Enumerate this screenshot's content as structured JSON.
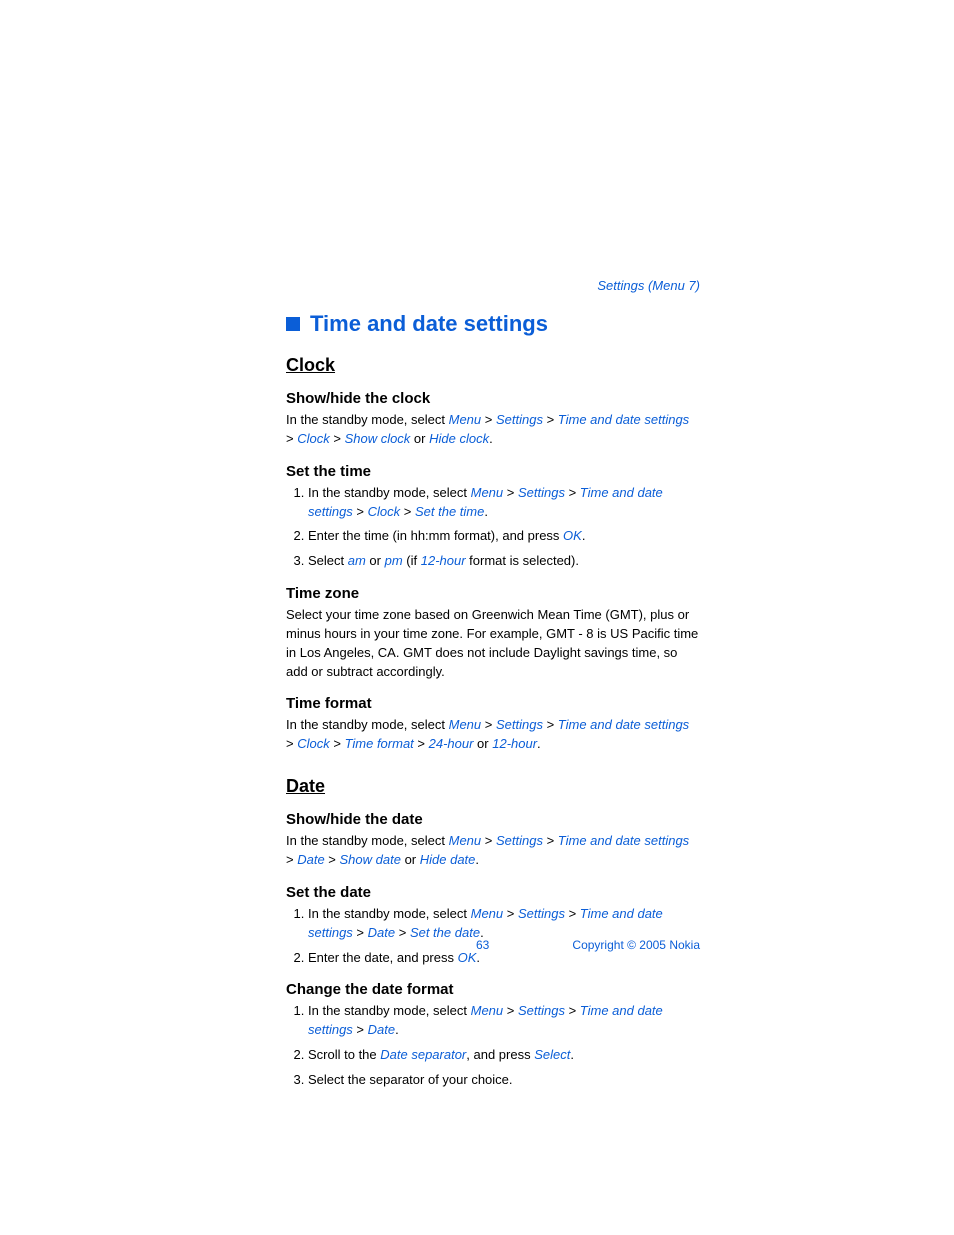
{
  "header": {
    "breadcrumb": "Settings (Menu 7)"
  },
  "title": "Time and date settings",
  "sec_clock": "Clock",
  "clock_showhide": {
    "h": "Show/hide the clock",
    "pre": "In the standby mode, select ",
    "menu": "Menu",
    "gt1": " > ",
    "settings": "Settings",
    "gt2": " > ",
    "tads": "Time and date settings",
    "gt3": " > ",
    "clock": "Clock",
    "gt4": " > ",
    "showclock": "Show clock",
    "or": " or ",
    "hideclock": "Hide clock",
    "dot": "."
  },
  "set_time": {
    "h": "Set the time",
    "s1_pre": "In the standby mode, select ",
    "s1_menu": "Menu",
    "s1_gt1": " > ",
    "s1_settings": "Settings",
    "s1_gt2": " > ",
    "s1_tads": "Time and date settings",
    "s1_gt3": " > ",
    "s1_clock": "Clock",
    "s1_gt4": " > ",
    "s1_st": "Set the time",
    "s1_dot": ".",
    "s2_pre": "Enter the time (in hh:mm format), and press ",
    "s2_ok": "OK",
    "s2_dot": ".",
    "s3_pre": "Select ",
    "s3_am": "am",
    "s3_or": " or ",
    "s3_pm": "pm",
    "s3_if": " (if ",
    "s3_12h": "12-hour",
    "s3_post": " format is selected)."
  },
  "time_zone": {
    "h": "Time zone",
    "p": "Select your time zone based on Greenwich Mean Time (GMT), plus or minus hours in your time zone. For example, GMT - 8 is US Pacific time in Los Angeles, CA. GMT does not include Daylight savings time, so add or subtract accordingly."
  },
  "time_format": {
    "h": "Time format",
    "pre": "In the standby mode, select ",
    "menu": "Menu",
    "gt1": " > ",
    "settings": "Settings",
    "gt2": " > ",
    "tads": "Time and date settings",
    "gt3": " > ",
    "clock": "Clock",
    "gt4": " > ",
    "tf": "Time format",
    "gt5": " > ",
    "h24": "24-hour",
    "or": " or ",
    "h12": "12-hour",
    "dot": "."
  },
  "sec_date": "Date",
  "date_showhide": {
    "h": "Show/hide the date",
    "pre": "In the standby mode, select ",
    "menu": "Menu",
    "gt1": " > ",
    "settings": "Settings",
    "gt2": " > ",
    "tads": "Time and date settings",
    "gt3": " > ",
    "date": "Date",
    "gt4": " > ",
    "showdate": "Show date",
    "or": " or ",
    "hidedate": "Hide date",
    "dot": "."
  },
  "set_date": {
    "h": "Set the date",
    "s1_pre": "In the standby mode, select ",
    "s1_menu": "Menu",
    "s1_gt1": " > ",
    "s1_settings": "Settings",
    "s1_gt2": " > ",
    "s1_tads": "Time and date settings",
    "s1_gt3": " > ",
    "s1_date": "Date",
    "s1_gt4": " > ",
    "s1_sd": "Set the date",
    "s1_dot": ".",
    "s2_pre": "Enter the date, and press ",
    "s2_ok": "OK",
    "s2_dot": "."
  },
  "change_fmt": {
    "h": "Change the date format",
    "s1_pre": "In the standby mode, select ",
    "s1_menu": "Menu",
    "s1_gt1": " > ",
    "s1_settings": "Settings",
    "s1_gt2": " > ",
    "s1_tads": "Time and date settings",
    "s1_gt3": " > ",
    "s1_date": "Date",
    "s1_dot": ".",
    "s2_pre": "Scroll to the ",
    "s2_ds": "Date separator",
    "s2_mid": ", and press ",
    "s2_select": "Select",
    "s2_dot": ".",
    "s3": "Select the separator of your choice."
  },
  "footer": {
    "page": "63",
    "copyright": "Copyright © 2005 Nokia"
  }
}
